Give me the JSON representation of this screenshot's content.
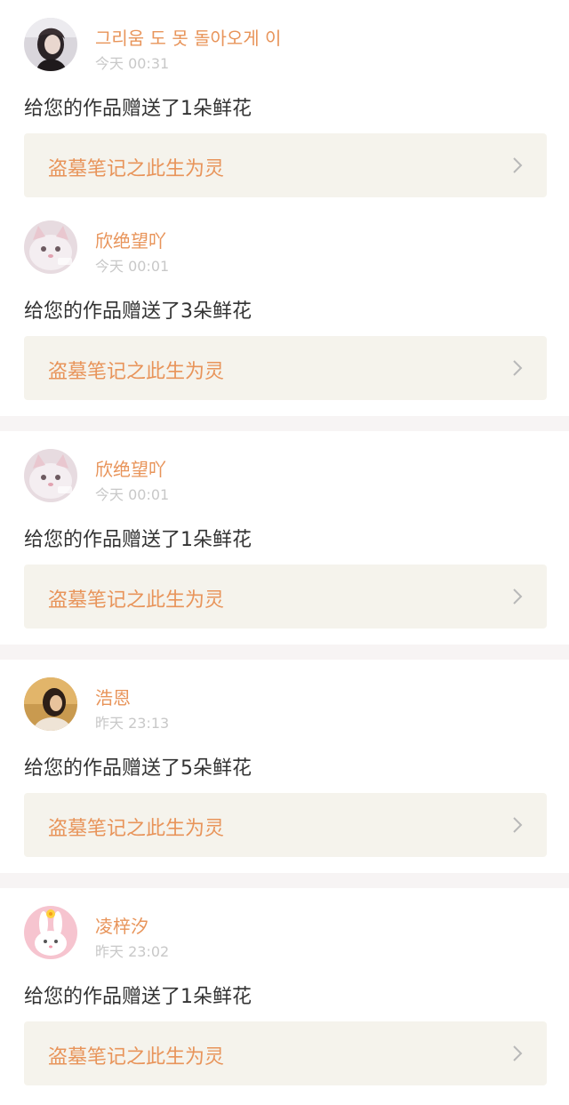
{
  "notifications": [
    {
      "username": "그리움 도 못 돌아오게 이",
      "time": "今天 00:31",
      "message": "给您的作品赠送了1朵鲜花",
      "work_title": "盗墓笔记之此生为灵",
      "avatar": "avatar-girl-dark-hair"
    },
    {
      "username": "欣绝望吖",
      "time": "今天 00:01",
      "message": "给您的作品赠送了3朵鲜花",
      "work_title": "盗墓笔记之此生为灵",
      "avatar": "avatar-cat"
    },
    {
      "username": "欣绝望吖",
      "time": "今天 00:01",
      "message": "给您的作品赠送了1朵鲜花",
      "work_title": "盗墓笔记之此生为灵",
      "avatar": "avatar-cat"
    },
    {
      "username": "浩恩",
      "time": "昨天 23:13",
      "message": "给您的作品赠送了5朵鲜花",
      "work_title": "盗墓笔记之此生为灵",
      "avatar": "avatar-warm-portrait"
    },
    {
      "username": "凌梓汐",
      "time": "昨天 23:02",
      "message": "给您的作品赠送了1朵鲜花",
      "work_title": "盗墓笔记之此生为灵",
      "avatar": "avatar-pink-bunny"
    }
  ],
  "colors": {
    "accent": "#e8945a",
    "link_bg": "#f5f3ec",
    "separator": "#f7f4f4",
    "time": "#c8c8c8",
    "message": "#333333"
  }
}
